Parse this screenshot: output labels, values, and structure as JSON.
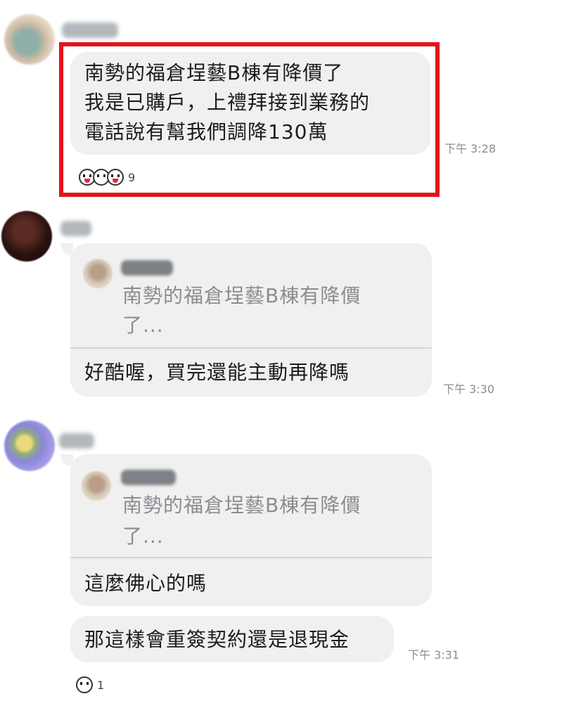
{
  "messages": [
    {
      "text_lines": [
        "南勢的福倉埕藝B棟有降價了",
        "我是已購戶，上禮拜接到業務的",
        "電話說有幫我們調降130萬"
      ],
      "time": "下午 3:28",
      "reactions": {
        "count": "9",
        "icons": [
          "surprised-face-icon",
          "smile-face-icon",
          "laugh-face-icon"
        ]
      },
      "highlighted": true,
      "highlight_color": "#e3141b"
    },
    {
      "quote": {
        "lines": [
          "南勢的福倉埕藝B棟有降價",
          "了..."
        ]
      },
      "text": "好酷喔，買完還能主動再降嗎",
      "time": "下午 3:30"
    },
    {
      "quote": {
        "lines": [
          "南勢的福倉埕藝B棟有降價",
          "了..."
        ]
      },
      "text": "這麼佛心的嗎"
    },
    {
      "text": "那這樣會重簽契約還是退現金",
      "time": "下午 3:31",
      "reactions": {
        "count": "1",
        "icons": [
          "smile-face-icon"
        ]
      }
    }
  ],
  "colors": {
    "bubble": "#f0f0f0",
    "muted_text": "#8a8d91",
    "highlight": "#e3141b"
  }
}
